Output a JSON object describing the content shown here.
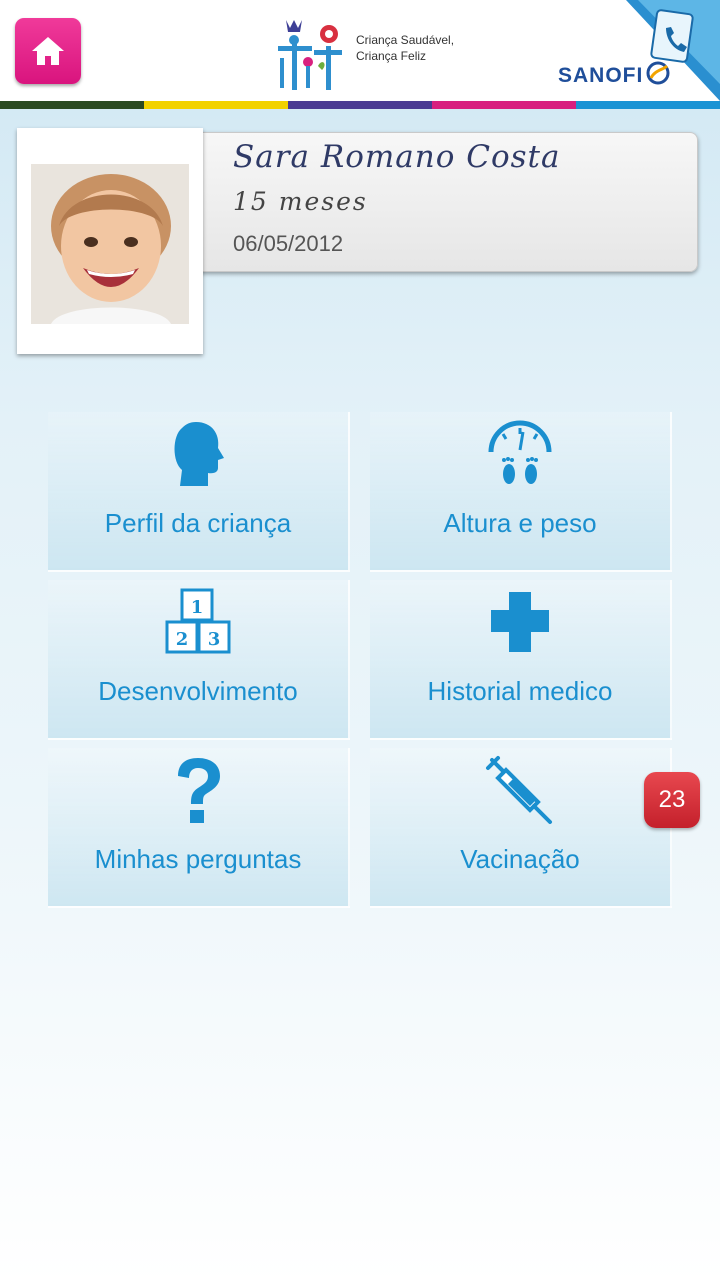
{
  "header": {
    "home_label": "home",
    "logo_line1": "Criança Saudável,",
    "logo_line2": "Criança Feliz",
    "brand": "SANOFI",
    "stripe_colors": [
      "#2a4a22",
      "#f2d200",
      "#4a3b93",
      "#d8207f",
      "#1a93d4"
    ]
  },
  "profile": {
    "name": "Sara Romano Costa",
    "age": "15 meses",
    "date": "06/05/2012"
  },
  "menu": {
    "items": [
      {
        "label": "Perfil da criança",
        "icon": "child-head-icon"
      },
      {
        "label": "Altura e peso",
        "icon": "scale-feet-icon"
      },
      {
        "label": "Desenvolvimento",
        "icon": "blocks-123-icon"
      },
      {
        "label": "Historial medico",
        "icon": "medical-cross-icon"
      },
      {
        "label": "Minhas perguntas",
        "icon": "question-mark-icon"
      },
      {
        "label": "Vacinação",
        "icon": "syringe-icon"
      }
    ],
    "badge": "23"
  },
  "colors": {
    "accent": "#1a8fcf",
    "home": "#e0197f",
    "badge": "#d52b35"
  }
}
